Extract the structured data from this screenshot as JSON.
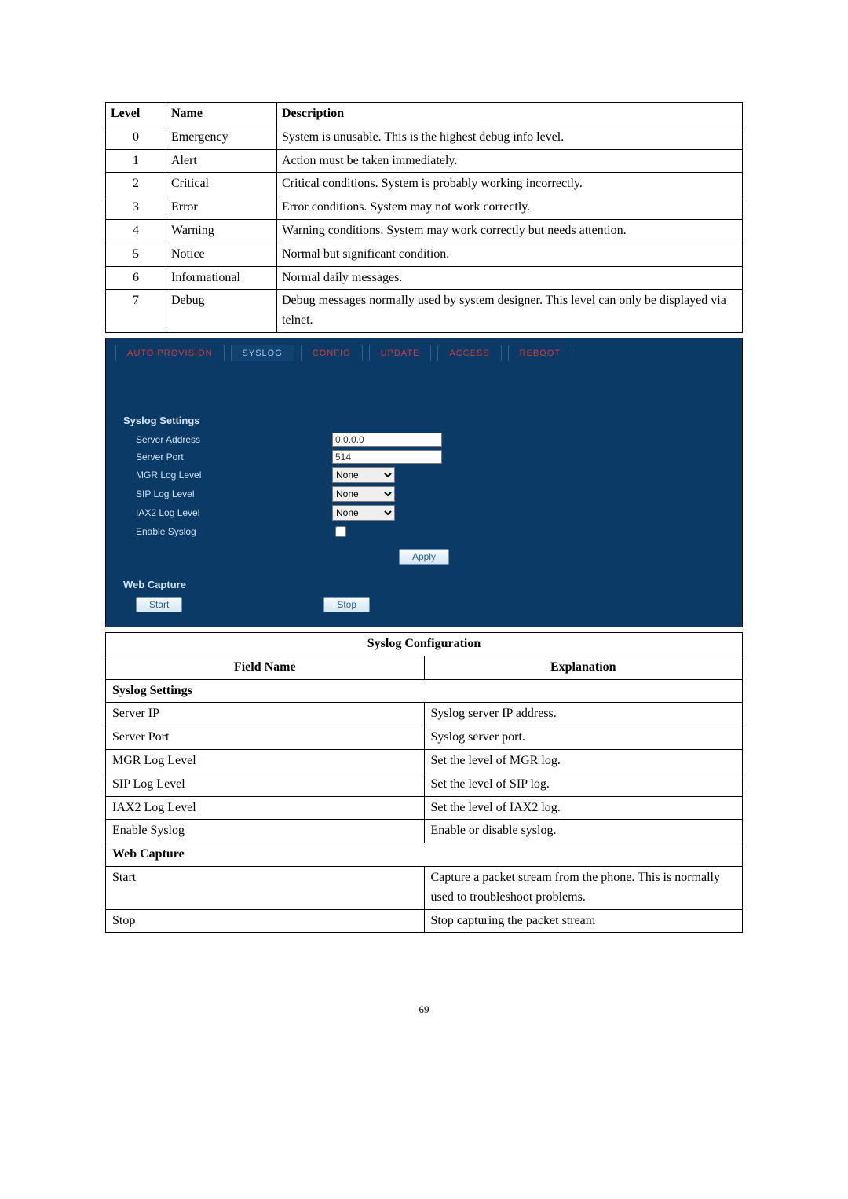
{
  "levels_table": {
    "headers": [
      "Level",
      "Name",
      "Description"
    ],
    "rows": [
      {
        "level": "0",
        "name": "Emergency",
        "desc": "System is unusable.    This is the highest debug info level."
      },
      {
        "level": "1",
        "name": "Alert",
        "desc": "Action must be taken immediately."
      },
      {
        "level": "2",
        "name": "Critical",
        "desc": "Critical conditions. System is probably working incorrectly."
      },
      {
        "level": "3",
        "name": "Error",
        "desc": "Error conditions. System may not work correctly."
      },
      {
        "level": "4",
        "name": "Warning",
        "desc": "Warning conditions. System may work correctly but needs attention."
      },
      {
        "level": "5",
        "name": "Notice",
        "desc": "Normal but significant condition."
      },
      {
        "level": "6",
        "name": "Informational",
        "desc": "Normal daily messages."
      },
      {
        "level": "7",
        "name": "Debug",
        "desc": "Debug messages normally used by system designer.    This level can only be displayed via telnet."
      }
    ]
  },
  "ui": {
    "tabs": {
      "auto_provision": "AUTO PROVISION",
      "syslog": "SYSLOG",
      "config": "CONFIG",
      "update": "UPDATE",
      "access": "ACCESS",
      "reboot": "REBOOT"
    },
    "syslog": {
      "heading": "Syslog Settings",
      "server_address_label": "Server Address",
      "server_address_value": "0.0.0.0",
      "server_port_label": "Server Port",
      "server_port_value": "514",
      "mgr_label": "MGR Log Level",
      "mgr_value": "None",
      "sip_label": "SIP Log Level",
      "sip_value": "None",
      "iax2_label": "IAX2 Log Level",
      "iax2_value": "None",
      "enable_label": "Enable Syslog",
      "apply_label": "Apply"
    },
    "capture": {
      "heading": "Web Capture",
      "start_label": "Start",
      "stop_label": "Stop"
    }
  },
  "config_table": {
    "title": "Syslog Configuration",
    "field_header": "Field Name",
    "explanation_header": "Explanation",
    "section1": "Syslog Settings",
    "rows1": [
      {
        "field": "Server IP",
        "expl": "Syslog server IP address."
      },
      {
        "field": "Server Port",
        "expl": "Syslog server port."
      },
      {
        "field": "MGR Log Level",
        "expl": "Set the level of MGR log."
      },
      {
        "field": "SIP Log Level",
        "expl": "Set the level of SIP log."
      },
      {
        "field": "IAX2 Log Level",
        "expl": "Set the level of IAX2 log."
      },
      {
        "field": "Enable Syslog",
        "expl": "Enable or disable syslog."
      }
    ],
    "section2": "Web Capture",
    "rows2": [
      {
        "field": "Start",
        "expl": "Capture a packet stream from the phone.    This is normally used to troubleshoot problems."
      },
      {
        "field": "Stop",
        "expl": "Stop capturing the packet stream"
      }
    ]
  },
  "page_number": "69"
}
